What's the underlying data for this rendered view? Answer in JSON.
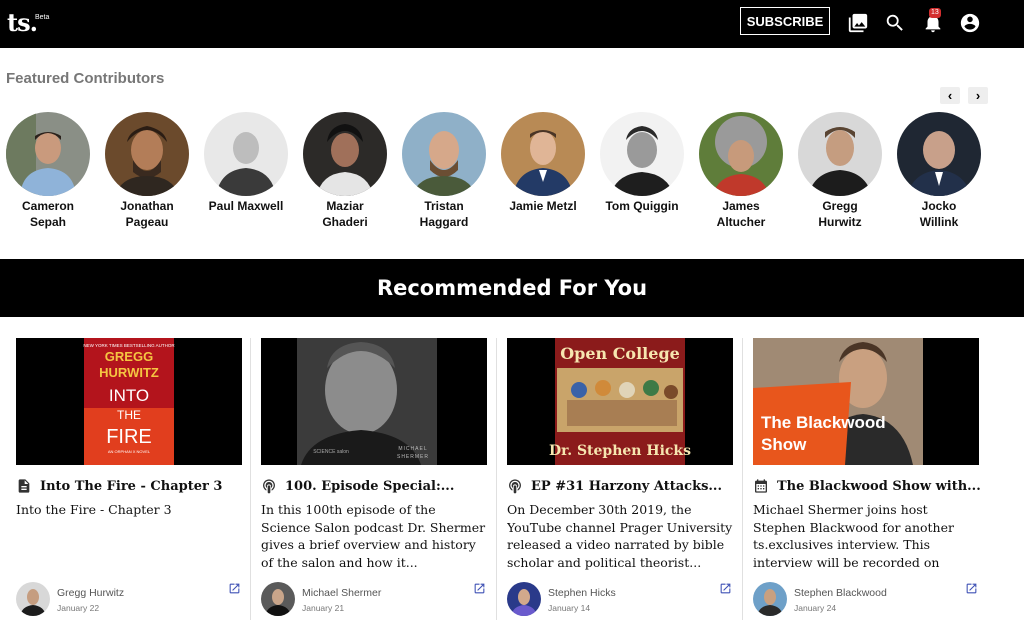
{
  "header": {
    "logo": "ts.",
    "logo_badge": "Beta",
    "subscribe_label": "SUBSCRIBE",
    "notification_count": "13",
    "icons": [
      "library-icon",
      "search-icon",
      "bell-icon",
      "account-icon"
    ]
  },
  "featured": {
    "title": "Featured Contributors",
    "prev": "‹",
    "next": "›",
    "contributors": [
      {
        "name": "Cameron Sepah"
      },
      {
        "name": "Jonathan Pageau"
      },
      {
        "name": "Paul Maxwell"
      },
      {
        "name": "Maziar Ghaderi"
      },
      {
        "name": "Tristan Haggard"
      },
      {
        "name": "Jamie Metzl"
      },
      {
        "name": "Tom Quiggin"
      },
      {
        "name": "James Altucher"
      },
      {
        "name": "Gregg Hurwitz"
      },
      {
        "name": "Jocko Willink"
      }
    ]
  },
  "recommended": {
    "title": "Recommended For You",
    "cards": [
      {
        "type_icon": "document-icon",
        "title": "Into The Fire - Chapter 3",
        "description": "Into the Fire - Chapter 3",
        "author": "Gregg Hurwitz",
        "date": "January 22",
        "thumb": {
          "top": "NEW YORK TIMES BESTSELLING AUTHOR",
          "l1": "GREGG",
          "l2": "HURWITZ",
          "l3": "INTO",
          "l4": "THE",
          "l5": "FIRE",
          "foot": "AN ORPHAN X NOVEL"
        }
      },
      {
        "type_icon": "podcast-icon",
        "title": "100. Episode Special:...",
        "description": "In this 100th episode of the Science Salon podcast Dr. Shermer gives a brief overview and history of the salon and how it...",
        "author": "Michael Shermer",
        "date": "January 21",
        "thumb": {
          "brand": "SCIENCE salon",
          "l1": "MICHAEL",
          "l2": "SHERMER"
        }
      },
      {
        "type_icon": "podcast-icon",
        "title": "EP #31 Harzony Attacks...",
        "description": "On December 30th 2019, the YouTube channel Prager University released a video narrated by bible scholar and political theorist...",
        "author": "Stephen Hicks",
        "date": "January 14",
        "thumb": {
          "l1": "Open College",
          "l2": "Dr. Stephen Hicks"
        }
      },
      {
        "type_icon": "calendar-icon",
        "title": "The Blackwood Show with...",
        "description": "Michael Shermer joins host Stephen Blackwood for another ts.exclusives interview. This interview will be recorded on Tuesday,...",
        "author": "Stephen Blackwood",
        "date": "January 24",
        "thumb": {
          "l1": "The Blackwood",
          "l2": "Show"
        }
      }
    ]
  },
  "colors": {
    "accent": "#3f51b5",
    "badge": "#d32f2f",
    "bar": "#000000"
  }
}
